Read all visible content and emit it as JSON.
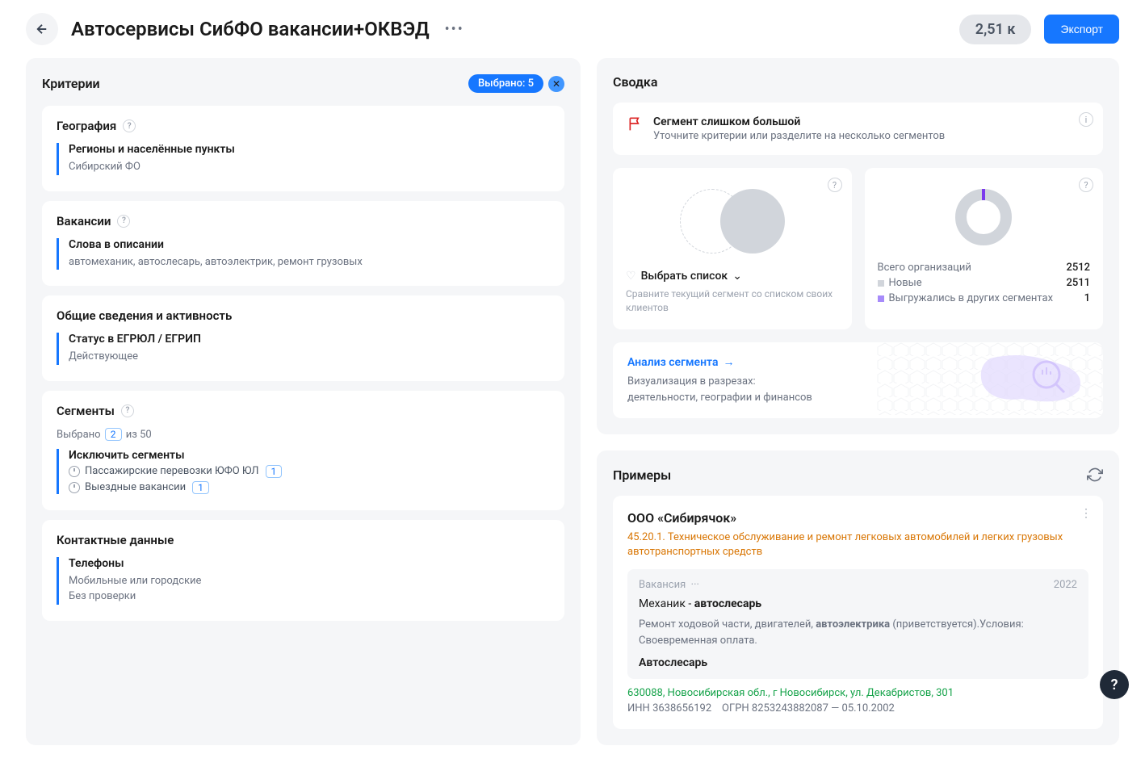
{
  "header": {
    "title": "Автосервисы СибФО вакансии+ОКВЭД",
    "count": "2,51 к",
    "export": "Экспорт"
  },
  "criteria": {
    "title": "Критерии",
    "selected_label": "Выбрано: 5",
    "groups": [
      {
        "title": "География",
        "help": true,
        "items": [
          {
            "label": "Регионы и населённые пункты",
            "value": "Сибирский ФО"
          }
        ]
      },
      {
        "title": "Вакансии",
        "help": true,
        "items": [
          {
            "label": "Слова в описании",
            "value": "автомеханик, автослесарь, автоэлектрик, ремонт грузовых"
          }
        ]
      },
      {
        "title": "Общие сведения и активность",
        "help": false,
        "items": [
          {
            "label": "Статус в ЕГРЮЛ / ЕГРИП",
            "value": "Действующее"
          }
        ]
      }
    ],
    "segments": {
      "title": "Сегменты",
      "selected_prefix": "Выбрано",
      "selected_count": "2",
      "selected_suffix": "из 50",
      "exclude_label": "Исключить сегменты",
      "items": [
        {
          "name": "Пассажирские перевозки ЮФО ЮЛ",
          "badge": "1"
        },
        {
          "name": "Выездные вакансии",
          "badge": "1"
        }
      ]
    },
    "contacts": {
      "title": "Контактные данные",
      "label": "Телефоны",
      "line1": "Мобильные или городские",
      "line2": "Без проверки"
    }
  },
  "summary": {
    "title": "Сводка",
    "warning": {
      "title": "Сегмент слишком большой",
      "sub": "Уточните критерии или разделите на несколько сегментов"
    },
    "compare": {
      "label": "Выбрать список",
      "sub": "Сравните текущий сегмент со списком своих клиентов"
    },
    "stats": {
      "total_label": "Всего организаций",
      "total": "2512",
      "new_label": "Новые",
      "new": "2511",
      "exported_label": "Выгружались в других сегментах",
      "exported": "1"
    },
    "analysis": {
      "link": "Анализ сегмента",
      "sub1": "Визуализация в разрезах:",
      "sub2": "деятельности, географии и финансов"
    }
  },
  "examples": {
    "title": "Примеры",
    "item": {
      "name": "ООО «Сибирячок»",
      "okved_code": "45.20.1.",
      "okved_text": "Техническое обслуживание и ремонт легковых автомобилей и легких грузовых автотранспортных средств",
      "vacancy_label": "Вакансия",
      "vacancy_year": "2022",
      "vacancy_title_plain": "Механик - ",
      "vacancy_title_bold": "автослесарь",
      "vacancy_desc_1": "Ремонт ходовой части, двигателей, ",
      "vacancy_desc_bold": "автоэлектрика",
      "vacancy_desc_2": " (приветствуется).Условия: Своевременная оплата.",
      "vacancy_title2": "Автослесарь",
      "address": "630088, Новосибирская обл., г Новосибирск, ул. Декабристов, 301",
      "inn_label": "ИНН",
      "inn": "3638656192",
      "ogrn_label": "ОГРН",
      "ogrn": "8253243882087",
      "date": "05.10.2002"
    }
  }
}
